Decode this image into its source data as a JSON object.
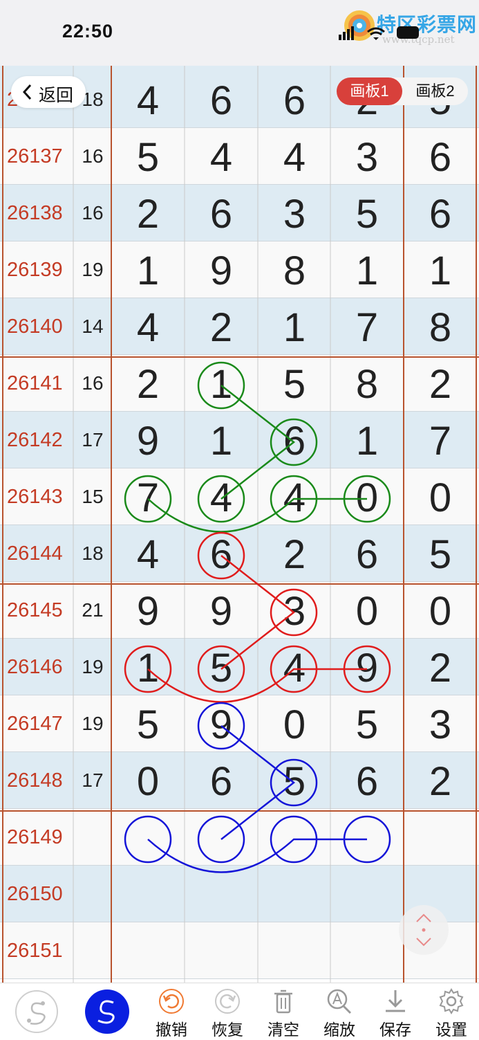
{
  "status_bar": {
    "time": "22:50"
  },
  "logo": {
    "text": "特区彩票网",
    "url": "www.tqcp.net"
  },
  "header": {
    "back_label": "返回",
    "tabs": [
      "画板1",
      "画板2"
    ],
    "active_tab": "画板1"
  },
  "rows": [
    {
      "issue": "26136",
      "sum": "18",
      "digits": [
        "4",
        "6",
        "6",
        "2",
        "5"
      ]
    },
    {
      "issue": "26137",
      "sum": "16",
      "digits": [
        "5",
        "4",
        "4",
        "3",
        "6"
      ]
    },
    {
      "issue": "26138",
      "sum": "16",
      "digits": [
        "2",
        "6",
        "3",
        "5",
        "6"
      ]
    },
    {
      "issue": "26139",
      "sum": "19",
      "digits": [
        "1",
        "9",
        "8",
        "1",
        "1"
      ]
    },
    {
      "issue": "26140",
      "sum": "14",
      "digits": [
        "4",
        "2",
        "1",
        "7",
        "8"
      ]
    },
    {
      "issue": "26141",
      "sum": "16",
      "digits": [
        "2",
        "1",
        "5",
        "8",
        "2"
      ]
    },
    {
      "issue": "26142",
      "sum": "17",
      "digits": [
        "9",
        "1",
        "6",
        "1",
        "7"
      ]
    },
    {
      "issue": "26143",
      "sum": "15",
      "digits": [
        "7",
        "4",
        "4",
        "0",
        "0"
      ]
    },
    {
      "issue": "26144",
      "sum": "18",
      "digits": [
        "4",
        "6",
        "2",
        "6",
        "5"
      ]
    },
    {
      "issue": "26145",
      "sum": "21",
      "digits": [
        "9",
        "9",
        "3",
        "0",
        "0"
      ]
    },
    {
      "issue": "26146",
      "sum": "19",
      "digits": [
        "1",
        "5",
        "4",
        "9",
        "2"
      ]
    },
    {
      "issue": "26147",
      "sum": "19",
      "digits": [
        "5",
        "9",
        "0",
        "5",
        "3"
      ]
    },
    {
      "issue": "26148",
      "sum": "17",
      "digits": [
        "0",
        "6",
        "5",
        "6",
        "2"
      ]
    },
    {
      "issue": "26149",
      "sum": "",
      "digits": [
        "",
        "",
        "",
        "",
        ""
      ]
    },
    {
      "issue": "26150",
      "sum": "",
      "digits": [
        "",
        "",
        "",
        "",
        ""
      ]
    },
    {
      "issue": "26151",
      "sum": "",
      "digits": [
        "",
        "",
        "",
        "",
        ""
      ]
    }
  ],
  "drawings": [
    {
      "color": "#1a8a1a",
      "circles": [
        [
          5,
          1
        ],
        [
          6,
          2
        ],
        [
          7,
          0
        ],
        [
          7,
          1
        ],
        [
          7,
          2
        ],
        [
          7,
          3
        ]
      ]
    },
    {
      "color": "#e01c1c",
      "circles": [
        [
          8,
          1
        ],
        [
          9,
          2
        ],
        [
          10,
          0
        ],
        [
          10,
          1
        ],
        [
          10,
          2
        ],
        [
          10,
          3
        ]
      ]
    },
    {
      "color": "#1414d8",
      "circles": [
        [
          11,
          1
        ],
        [
          12,
          2
        ],
        [
          13,
          0
        ],
        [
          13,
          1
        ],
        [
          13,
          2
        ],
        [
          13,
          3
        ]
      ]
    }
  ],
  "toolbar": {
    "items": [
      {
        "label": "",
        "icon": "pen-mode-icon"
      },
      {
        "label": "",
        "icon": "curve-pen-icon"
      },
      {
        "label": "撤销",
        "icon": "undo-icon"
      },
      {
        "label": "恢复",
        "icon": "redo-icon"
      },
      {
        "label": "清空",
        "icon": "trash-icon"
      },
      {
        "label": "缩放",
        "icon": "zoom-icon"
      },
      {
        "label": "保存",
        "icon": "download-icon"
      },
      {
        "label": "设置",
        "icon": "gear-icon"
      }
    ]
  },
  "colors": {
    "issue_text": "#c43b24",
    "grid_line": "#b8532e",
    "undo_accent": "#f07a33",
    "pen_active": "#0a1fe0"
  }
}
